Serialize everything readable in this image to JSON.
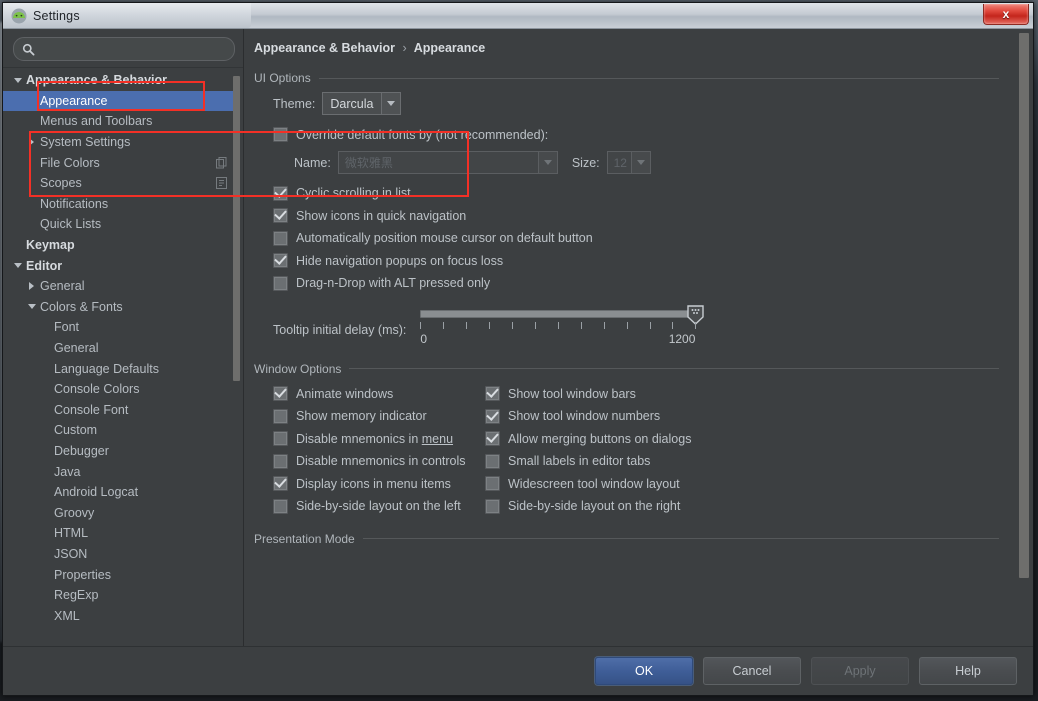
{
  "window": {
    "title": "Settings",
    "icon": "android-studio-icon",
    "close_label": "x"
  },
  "search": {
    "value": "",
    "placeholder": "",
    "icon": "search-icon"
  },
  "tree": {
    "items": [
      {
        "label": "Appearance & Behavior",
        "indent": 0,
        "arrow": "down",
        "bold": true,
        "selected": false,
        "trailing_icon": ""
      },
      {
        "label": "Appearance",
        "indent": 1,
        "arrow": "none",
        "bold": false,
        "selected": true,
        "trailing_icon": ""
      },
      {
        "label": "Menus and Toolbars",
        "indent": 1,
        "arrow": "none",
        "bold": false,
        "selected": false,
        "trailing_icon": ""
      },
      {
        "label": "System Settings",
        "indent": 1,
        "arrow": "right",
        "bold": false,
        "selected": false,
        "trailing_icon": ""
      },
      {
        "label": "File Colors",
        "indent": 1,
        "arrow": "none",
        "bold": false,
        "selected": false,
        "trailing_icon": "copy-icon"
      },
      {
        "label": "Scopes",
        "indent": 1,
        "arrow": "none",
        "bold": false,
        "selected": false,
        "trailing_icon": "scope-icon"
      },
      {
        "label": "Notifications",
        "indent": 1,
        "arrow": "none",
        "bold": false,
        "selected": false,
        "trailing_icon": ""
      },
      {
        "label": "Quick Lists",
        "indent": 1,
        "arrow": "none",
        "bold": false,
        "selected": false,
        "trailing_icon": ""
      },
      {
        "label": "Keymap",
        "indent": 0,
        "arrow": "none",
        "bold": true,
        "selected": false,
        "trailing_icon": ""
      },
      {
        "label": "Editor",
        "indent": 0,
        "arrow": "down",
        "bold": true,
        "selected": false,
        "trailing_icon": ""
      },
      {
        "label": "General",
        "indent": 1,
        "arrow": "right",
        "bold": false,
        "selected": false,
        "trailing_icon": ""
      },
      {
        "label": "Colors & Fonts",
        "indent": 1,
        "arrow": "down",
        "bold": false,
        "selected": false,
        "trailing_icon": ""
      },
      {
        "label": "Font",
        "indent": 2,
        "arrow": "none",
        "bold": false,
        "selected": false,
        "trailing_icon": ""
      },
      {
        "label": "General",
        "indent": 2,
        "arrow": "none",
        "bold": false,
        "selected": false,
        "trailing_icon": ""
      },
      {
        "label": "Language Defaults",
        "indent": 2,
        "arrow": "none",
        "bold": false,
        "selected": false,
        "trailing_icon": ""
      },
      {
        "label": "Console Colors",
        "indent": 2,
        "arrow": "none",
        "bold": false,
        "selected": false,
        "trailing_icon": ""
      },
      {
        "label": "Console Font",
        "indent": 2,
        "arrow": "none",
        "bold": false,
        "selected": false,
        "trailing_icon": ""
      },
      {
        "label": "Custom",
        "indent": 2,
        "arrow": "none",
        "bold": false,
        "selected": false,
        "trailing_icon": ""
      },
      {
        "label": "Debugger",
        "indent": 2,
        "arrow": "none",
        "bold": false,
        "selected": false,
        "trailing_icon": ""
      },
      {
        "label": "Java",
        "indent": 2,
        "arrow": "none",
        "bold": false,
        "selected": false,
        "trailing_icon": ""
      },
      {
        "label": "Android Logcat",
        "indent": 2,
        "arrow": "none",
        "bold": false,
        "selected": false,
        "trailing_icon": ""
      },
      {
        "label": "Groovy",
        "indent": 2,
        "arrow": "none",
        "bold": false,
        "selected": false,
        "trailing_icon": ""
      },
      {
        "label": "HTML",
        "indent": 2,
        "arrow": "none",
        "bold": false,
        "selected": false,
        "trailing_icon": ""
      },
      {
        "label": "JSON",
        "indent": 2,
        "arrow": "none",
        "bold": false,
        "selected": false,
        "trailing_icon": ""
      },
      {
        "label": "Properties",
        "indent": 2,
        "arrow": "none",
        "bold": false,
        "selected": false,
        "trailing_icon": ""
      },
      {
        "label": "RegExp",
        "indent": 2,
        "arrow": "none",
        "bold": false,
        "selected": false,
        "trailing_icon": ""
      },
      {
        "label": "XML",
        "indent": 2,
        "arrow": "none",
        "bold": false,
        "selected": false,
        "trailing_icon": ""
      }
    ]
  },
  "breadcrumb": {
    "root": "Appearance & Behavior",
    "separator": "›",
    "leaf": "Appearance"
  },
  "ui_options": {
    "title": "UI Options",
    "theme_label": "Theme:",
    "theme_value": "Darcula",
    "override_fonts": {
      "label": "Override default fonts by (not recommended):",
      "checked": false,
      "name_label": "Name:",
      "name_value": "微软雅黑",
      "size_label": "Size:",
      "size_value": "12"
    },
    "checkboxes": [
      {
        "label": "Cyclic scrolling in list",
        "checked": true
      },
      {
        "label": "Show icons in quick navigation",
        "checked": true
      },
      {
        "label": "Automatically position mouse cursor on default button",
        "checked": false
      },
      {
        "label": "Hide navigation popups on focus loss",
        "checked": true
      },
      {
        "label": "Drag-n-Drop with ALT pressed only",
        "checked": false
      }
    ],
    "tooltip_delay": {
      "label": "Tooltip initial delay (ms):",
      "min": "0",
      "max": "1200",
      "value": 1200,
      "ticks": 13
    }
  },
  "window_options": {
    "title": "Window Options",
    "left_column": [
      {
        "label": "Animate windows",
        "checked": true,
        "mnemonic": ""
      },
      {
        "label": "Show memory indicator",
        "checked": false,
        "mnemonic": ""
      },
      {
        "label": "Disable mnemonics in menu",
        "checked": false,
        "mnemonic": "menu"
      },
      {
        "label": "Disable mnemonics in controls",
        "checked": false,
        "mnemonic": ""
      },
      {
        "label": "Display icons in menu items",
        "checked": true,
        "mnemonic": ""
      },
      {
        "label": "Side-by-side layout on the left",
        "checked": false,
        "mnemonic": ""
      }
    ],
    "right_column": [
      {
        "label": "Show tool window bars",
        "checked": true,
        "mnemonic": ""
      },
      {
        "label": "Show tool window numbers",
        "checked": true,
        "mnemonic": ""
      },
      {
        "label": "Allow merging buttons on dialogs",
        "checked": true,
        "mnemonic": ""
      },
      {
        "label": "Small labels in editor tabs",
        "checked": false,
        "mnemonic": ""
      },
      {
        "label": "Widescreen tool window layout",
        "checked": false,
        "mnemonic": ""
      },
      {
        "label": "Side-by-side layout on the right",
        "checked": false,
        "mnemonic": ""
      }
    ]
  },
  "presentation_mode": {
    "title": "Presentation Mode"
  },
  "buttons": {
    "ok": "OK",
    "cancel": "Cancel",
    "apply": "Apply",
    "help": "Help"
  },
  "annotations": {
    "color": "#f33026",
    "boxes": [
      {
        "name": "appearance-tree-item-highlight"
      },
      {
        "name": "override-fonts-highlight"
      }
    ]
  },
  "colors": {
    "selection": "#4b6eaf",
    "panel_bg": "#3c3f41",
    "text": "#bcc2c7",
    "annotation": "#f33026",
    "default_button": "#3f5e98"
  }
}
